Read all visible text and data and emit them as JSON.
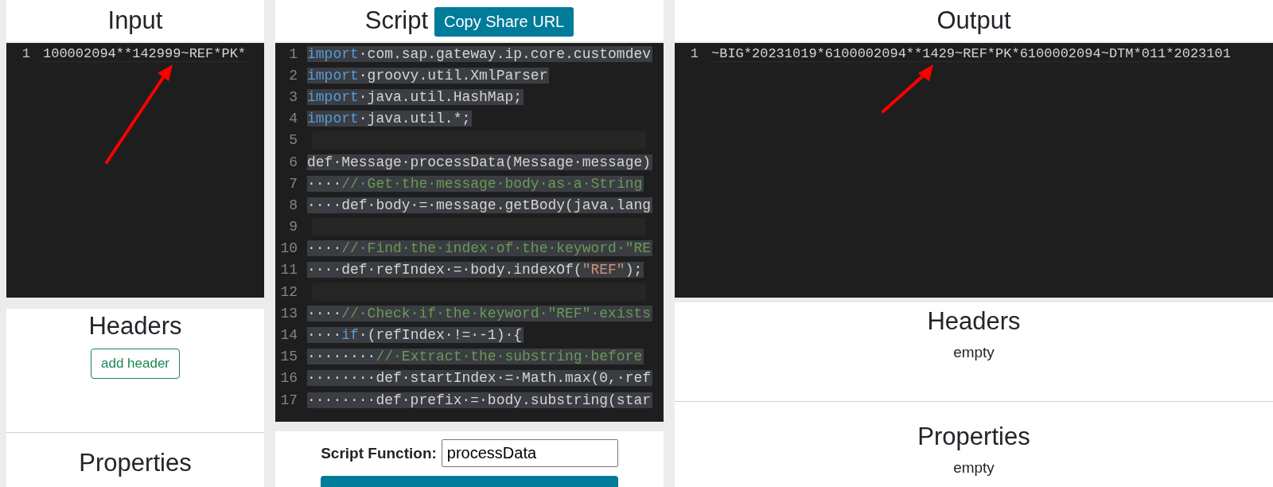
{
  "input": {
    "title": "Input",
    "lines": [
      {
        "number": "1",
        "text": "100002094**142999~REF*PK*"
      }
    ]
  },
  "script": {
    "title": "Script",
    "share_button": "Copy Share URL",
    "lines": [
      {
        "number": "1",
        "tokens": [
          {
            "kind": "keyword",
            "text": "import"
          },
          {
            "kind": "plain",
            "text": "·com.sap.gateway.ip.core.customdev"
          }
        ]
      },
      {
        "number": "2",
        "tokens": [
          {
            "kind": "keyword",
            "text": "import"
          },
          {
            "kind": "plain",
            "text": "·groovy.util.XmlParser"
          }
        ]
      },
      {
        "number": "3",
        "tokens": [
          {
            "kind": "keyword",
            "text": "import"
          },
          {
            "kind": "plain",
            "text": "·java.util.HashMap;"
          }
        ]
      },
      {
        "number": "4",
        "tokens": [
          {
            "kind": "keyword",
            "text": "import"
          },
          {
            "kind": "plain",
            "text": "·java.util.*;"
          }
        ]
      },
      {
        "number": "5"
      },
      {
        "number": "6",
        "tokens": [
          {
            "kind": "plain",
            "text": "def·Message·processData(Message·message)"
          }
        ]
      },
      {
        "number": "7",
        "tokens": [
          {
            "kind": "plain",
            "text": "····"
          },
          {
            "kind": "comment",
            "text": "//·Get·the·message·body·as·a·String"
          }
        ]
      },
      {
        "number": "8",
        "tokens": [
          {
            "kind": "plain",
            "text": "····def·body·=·message.getBody(java.lang"
          }
        ]
      },
      {
        "number": "9"
      },
      {
        "number": "10",
        "tokens": [
          {
            "kind": "plain",
            "text": "····"
          },
          {
            "kind": "comment",
            "text": "//·Find·the·index·of·the·keyword·\"RE"
          }
        ]
      },
      {
        "number": "11",
        "tokens": [
          {
            "kind": "plain",
            "text": "····def·refIndex·=·body.indexOf("
          },
          {
            "kind": "string",
            "text": "\"REF\""
          },
          {
            "kind": "plain",
            "text": ");"
          }
        ]
      },
      {
        "number": "12"
      },
      {
        "number": "13",
        "tokens": [
          {
            "kind": "plain",
            "text": "····"
          },
          {
            "kind": "comment",
            "text": "//·Check·if·the·keyword·\"REF\"·exists"
          }
        ]
      },
      {
        "number": "14",
        "tokens": [
          {
            "kind": "plain",
            "text": "····"
          },
          {
            "kind": "keyword",
            "text": "if"
          },
          {
            "kind": "plain",
            "text": "·(refIndex·!=·-1)·{"
          }
        ]
      },
      {
        "number": "15",
        "tokens": [
          {
            "kind": "plain",
            "text": "········"
          },
          {
            "kind": "comment",
            "text": "//·Extract·the·substring·before"
          }
        ]
      },
      {
        "number": "16",
        "tokens": [
          {
            "kind": "plain",
            "text": "········def·startIndex·=·Math.max(0,·ref"
          }
        ]
      },
      {
        "number": "17",
        "tokens": [
          {
            "kind": "plain",
            "text": "········def·prefix·=·body.substring(star"
          }
        ]
      }
    ],
    "function_label": "Script Function:",
    "function_value": "processData"
  },
  "input_headers": {
    "title": "Headers",
    "add_button": "add header"
  },
  "input_properties": {
    "title": "Properties"
  },
  "output": {
    "title": "Output",
    "lines": [
      {
        "number": "1",
        "text": "~BIG*20231019*6100002094**1429~REF*PK*6100002094~DTM*011*2023101"
      }
    ]
  },
  "output_headers": {
    "title": "Headers",
    "value": "empty"
  },
  "output_properties": {
    "title": "Properties",
    "value": "empty"
  }
}
